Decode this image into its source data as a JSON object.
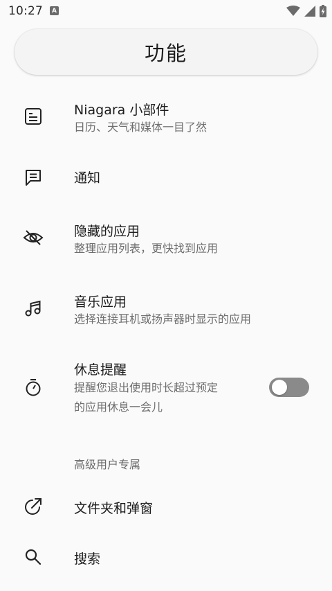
{
  "status_bar": {
    "time": "10:27",
    "notification_icon_letter": "A"
  },
  "header": {
    "title": "功能"
  },
  "items": [
    {
      "icon": "widget-icon",
      "label": "Niagara 小部件",
      "sub": "日历、天气和媒体一目了然"
    },
    {
      "icon": "notification-icon",
      "label": "通知",
      "sub": ""
    },
    {
      "icon": "eye-off-icon",
      "label": "隐藏的应用",
      "sub": "整理应用列表，更快找到应用"
    },
    {
      "icon": "music-note-icon",
      "label": "音乐应用",
      "sub": "选择连接耳机或扬声器时显示的应用"
    },
    {
      "icon": "timer-icon",
      "label": "休息提醒",
      "sub_line1": "提醒您退出使用时长超过预定",
      "sub_line2": "的应用休息一会儿",
      "toggle_on": false
    },
    {
      "icon": "external-link-icon",
      "label": "文件夹和弹窗",
      "sub": ""
    },
    {
      "icon": "search-icon",
      "label": "搜索",
      "sub": ""
    }
  ],
  "section": {
    "advanced_title": "高级用户专属"
  }
}
